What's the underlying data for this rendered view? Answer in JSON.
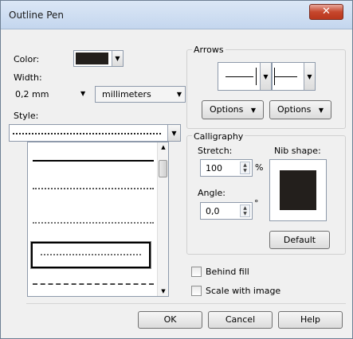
{
  "window": {
    "title": "Outline Pen",
    "close_glyph": "✕"
  },
  "color": {
    "label": "Color:",
    "swatch": "#231f1c"
  },
  "width": {
    "label": "Width:",
    "value": "0,2 mm",
    "unit": "millimeters"
  },
  "style": {
    "label": "Style:"
  },
  "arrows": {
    "title": "Arrows",
    "options_left_label": "Options",
    "options_right_label": "Options"
  },
  "calligraphy": {
    "title": "Calligraphy",
    "stretch_label": "Stretch:",
    "stretch_value": "100",
    "stretch_unit": "%",
    "angle_label": "Angle:",
    "angle_value": "0,0",
    "angle_unit": "°",
    "nib_label": "Nib shape:",
    "nib_color": "#231f1c",
    "default_label": "Default"
  },
  "behind_fill": {
    "label": "Behind fill",
    "checked": false
  },
  "scale_with_image": {
    "label": "Scale with image",
    "checked": false
  },
  "buttons": {
    "ok": "OK",
    "cancel": "Cancel",
    "help": "Help"
  }
}
